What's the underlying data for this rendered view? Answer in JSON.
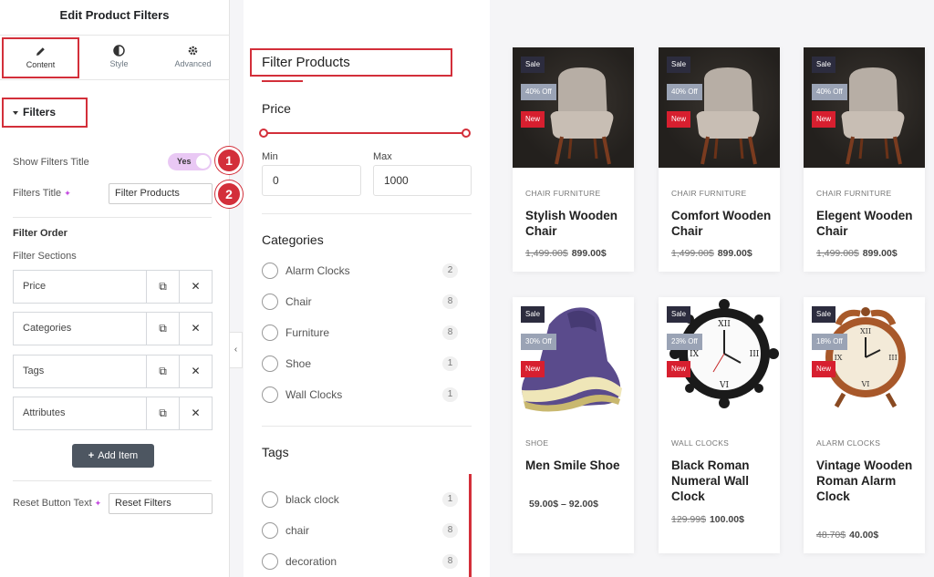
{
  "panel": {
    "title": "Edit Product Filters",
    "tabs": [
      {
        "label": "Content",
        "icon": "pencil-icon"
      },
      {
        "label": "Style",
        "icon": "half-circle-icon"
      },
      {
        "label": "Advanced",
        "icon": "gear-icon"
      }
    ],
    "section_title": "Filters",
    "show_filters_title": {
      "label": "Show Filters Title",
      "value": "Yes"
    },
    "filters_title": {
      "label": "Filters Title",
      "value": "Filter Products"
    },
    "filter_order_label": "Filter Order",
    "filter_sections_label": "Filter Sections",
    "sections": [
      "Price",
      "Categories",
      "Tags",
      "Attributes"
    ],
    "add_item_label": "Add Item",
    "reset_button": {
      "label": "Reset Button Text",
      "value": "Reset Filters"
    },
    "markers": [
      "1",
      "2"
    ]
  },
  "filters": {
    "title": "Filter Products",
    "price": {
      "heading": "Price",
      "min_label": "Min",
      "min_value": "0",
      "max_label": "Max",
      "max_value": "1000"
    },
    "categories": {
      "heading": "Categories",
      "items": [
        {
          "label": "Alarm Clocks",
          "count": "2"
        },
        {
          "label": "Chair",
          "count": "8"
        },
        {
          "label": "Furniture",
          "count": "8"
        },
        {
          "label": "Shoe",
          "count": "1"
        },
        {
          "label": "Wall Clocks",
          "count": "1"
        }
      ]
    },
    "tags": {
      "heading": "Tags",
      "items": [
        {
          "label": "black clock",
          "count": "1"
        },
        {
          "label": "chair",
          "count": "8"
        },
        {
          "label": "decoration",
          "count": "8"
        }
      ]
    }
  },
  "products": [
    {
      "sale": "Sale",
      "discount": "40% Off",
      "new": "New",
      "category": "CHAIR   FURNITURE",
      "name": "Stylish Wooden Chair",
      "old_price": "1,499.00$",
      "price": "899.00$",
      "image": "chair"
    },
    {
      "sale": "Sale",
      "discount": "40% Off",
      "new": "New",
      "category": "CHAIR   FURNITURE",
      "name": "Comfort Wooden Chair",
      "old_price": "1,499.00$",
      "price": "899.00$",
      "image": "chair"
    },
    {
      "sale": "Sale",
      "discount": "40% Off",
      "new": "New",
      "category": "CHAIR   FURNITURE",
      "name": "Elegent Wooden Chair",
      "old_price": "1,499.00$",
      "price": "899.00$",
      "image": "chair"
    },
    {
      "sale": "Sale",
      "discount": "30% Off",
      "new": "New",
      "category": "SHOE",
      "name": "Men Smile Shoe",
      "old_price": "",
      "price": "59.00$ – 92.00$",
      "image": "shoe"
    },
    {
      "sale": "Sale",
      "discount": "23% Off",
      "new": "New",
      "category": "WALL CLOCKS",
      "name": "Black Roman Numeral Wall Clock",
      "old_price": "129.99$",
      "price": "100.00$",
      "image": "wall-clock"
    },
    {
      "sale": "Sale",
      "discount": "18% Off",
      "new": "New",
      "category": "ALARM CLOCKS",
      "name": "Vintage Wooden Roman Alarm Clock",
      "old_price": "48.70$",
      "price": "40.00$",
      "image": "alarm-clock"
    }
  ],
  "colors": {
    "accent": "#d32f3a",
    "sale_tag": "#2c2c3e",
    "off_tag": "#9aa3b5",
    "new_tag": "#d71f2f",
    "toggle": "#e9c8f4"
  }
}
